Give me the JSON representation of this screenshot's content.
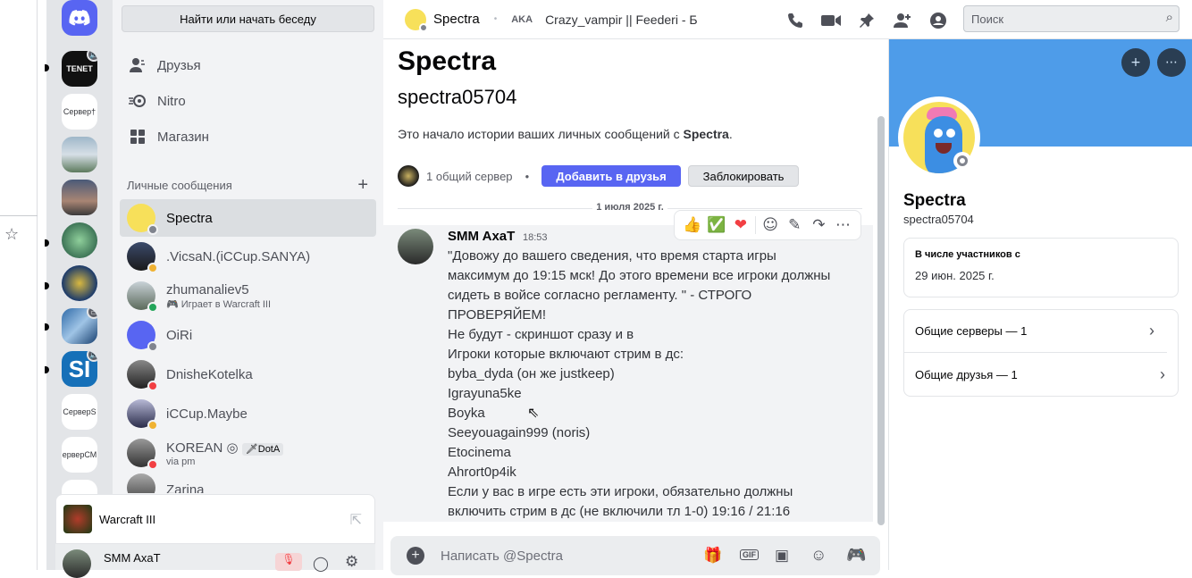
{
  "dm_column": {
    "search_button": "Найти или начать беседу",
    "nav": [
      {
        "label": "Друзья",
        "icon": "friends-icon"
      },
      {
        "label": "Nitro",
        "icon": "nitro-icon"
      },
      {
        "label": "Магазин",
        "icon": "shop-icon"
      }
    ],
    "dm_header": "Личные сообщения",
    "dm_add": "+",
    "dms": [
      {
        "name": "Spectra",
        "sub": ""
      },
      {
        "name": ".VicsaN.(iCCup.SANYA)",
        "sub": ""
      },
      {
        "name": "zhumanaliev5",
        "sub": "Играет в Warcraft III"
      },
      {
        "name": "OiRi",
        "sub": ""
      },
      {
        "name": "DnisheKotelka",
        "sub": ""
      },
      {
        "name": "iCCup.Maybe",
        "sub": ""
      },
      {
        "name": "KOREAN ◎",
        "tag": "DotA",
        "sub": "via pm"
      },
      {
        "name": "Zarina",
        "sub": ""
      }
    ],
    "activity": {
      "game": "Warcraft III"
    },
    "user": {
      "name": "SMM AxaT"
    }
  },
  "guilds": [
    {
      "label": "TENET"
    },
    {
      "label": "Сервер†"
    },
    {
      "label": "СерверS"
    },
    {
      "label": "ерверСМ"
    }
  ],
  "topbar": {
    "title": "Spectra",
    "aka_label": "AKA",
    "aka_value": "Crazy_vampir || Feederi - Б",
    "search_placeholder": "Поиск"
  },
  "chat": {
    "intro_title": "Spectra",
    "intro_username": "spectra05704",
    "intro_text": "Это начало истории ваших личных сообщений с ",
    "intro_name": "Spectra",
    "intro_end": ".",
    "mutual_servers": "1 общий сервер",
    "add_friend": "Добавить в друзья",
    "block": "Заблокировать",
    "date_divider": "1 июля 2025 г.",
    "message": {
      "author": "SMM AxaT",
      "time": "18:53",
      "lines": [
        "\"Довожу до вашего сведения, что время старта игры",
        "максимум до 19:15 мск! До этого времени все игроки должны",
        "сидеть в войсе согласно регламенту. \" - СТРОГО",
        "ПРОВЕРЯЙЕМ!",
        "Не будут - скриншот сразу и в",
        "Игроки которые включают стрим в дс:",
        "byba_dyda (он же justkeep)",
        "Igrayuna5ke",
        "Boyka",
        "Seeyouagain999 (noris)",
        "Etocinema",
        "Ahrort0p4ik",
        "Если у вас в игре есть эти игроки, обязательно должны",
        "включить стрим в дс (не включили тл 1-0) 19:16 / 21:16"
      ]
    },
    "composer_placeholder": "Написать @Spectra"
  },
  "profile": {
    "name": "Spectra",
    "username": "spectra05704",
    "member_since_label": "В числе участников с",
    "member_since": "29 июн. 2025 г.",
    "mutual_servers": "Общие серверы — 1",
    "mutual_friends": "Общие друзья — 1"
  },
  "colors": {
    "blurple": "#5865f2",
    "banner": "#4e9ce9",
    "online": "#23a55a",
    "dnd": "#f23f43",
    "idle": "#f0b232"
  }
}
